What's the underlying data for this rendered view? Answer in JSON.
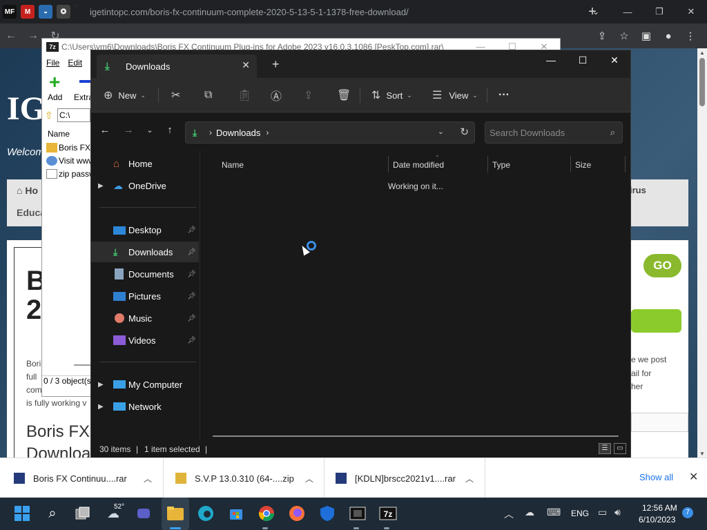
{
  "browser": {
    "tab_close": "✕",
    "tab_new": "+",
    "url": "igetintopc.com/boris-fx-continuum-complete-2020-5-13-5-1-1378-free-download/",
    "window_controls": [
      "⌄",
      "—",
      "❐",
      "✕"
    ]
  },
  "website": {
    "logo": "IG",
    "welcome": "Welcom",
    "nav_home": "Ho",
    "nav_education": "Educa",
    "nav_virus": "irus",
    "big_title_line1": "B",
    "big_title_line2": "2",
    "body_lines": [
      "Bori",
      "full",
      "compatible vers",
      "is fully working v"
    ],
    "heading_line1": "Boris FX",
    "heading_line2": "Downloa",
    "go_button": "GO",
    "right_lines": [
      "e we post",
      "ail for",
      "her"
    ]
  },
  "zip": {
    "app_icon": "7z",
    "title": "C:\\Users\\vm6\\Downloads\\Boris FX Continuum Plug-ins for Adobe 2023 v16.0.3.1086 [PeskTop.com].rar\\",
    "menu": [
      "File",
      "Edit"
    ],
    "add_label": "Add",
    "extract_label": "Extra",
    "path_value": "C:\\",
    "col_name": "Name",
    "rows": [
      "Boris FX",
      "Visit www",
      "zip passw"
    ],
    "status": "0 / 3 object(s"
  },
  "explorer": {
    "tab_title": "Downloads",
    "tab_close": "✕",
    "tab_new": "+",
    "cmd": {
      "new_label": "New",
      "sort_label": "Sort",
      "view_label": "View",
      "more": "···"
    },
    "address": {
      "location": "Downloads",
      "search_placeholder": "Search Downloads"
    },
    "sidebar": {
      "top": [
        {
          "label": "Home"
        },
        {
          "label": "OneDrive"
        }
      ],
      "pinned": [
        {
          "label": "Desktop"
        },
        {
          "label": "Downloads"
        },
        {
          "label": "Documents"
        },
        {
          "label": "Pictures"
        },
        {
          "label": "Music"
        },
        {
          "label": "Videos"
        }
      ],
      "bottom": [
        {
          "label": "My Computer"
        },
        {
          "label": "Network"
        }
      ]
    },
    "columns": [
      "Name",
      "Date modified",
      "Type",
      "Size"
    ],
    "working": "Working on it...",
    "status": {
      "items": "30 items",
      "selected": "1 item selected"
    }
  },
  "downloads_bar": {
    "items": [
      {
        "label": "Boris FX Continuu....rar"
      },
      {
        "label": "S.V.P 13.0.310 (64-....zip"
      },
      {
        "label": "[KDLN]brscc2021v1....rar"
      }
    ],
    "show_all": "Show all",
    "close": "✕"
  },
  "taskbar": {
    "weather_temp": "52°",
    "language": "ENG",
    "time": "12:56 AM",
    "date": "6/10/2023",
    "notifications": "7"
  },
  "colors": {
    "accent": "#3a8ee6",
    "downloads_green": "#3fc46c",
    "explorer_bg": "#191919"
  }
}
